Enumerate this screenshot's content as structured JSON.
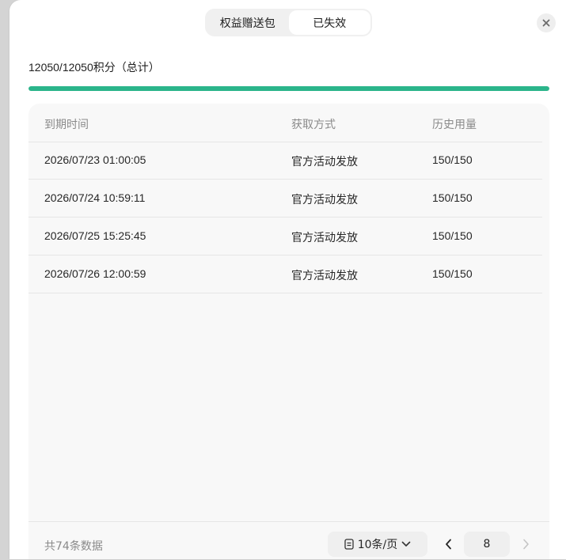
{
  "tabs": [
    {
      "label": "权益赠送包",
      "active": false
    },
    {
      "label": "已失效",
      "active": true
    }
  ],
  "summary": {
    "text": "12050/12050积分（总计）",
    "progress_fraction": 1.0
  },
  "table": {
    "columns": [
      "到期时间",
      "获取方式",
      "历史用量"
    ],
    "rows": [
      [
        "2026/07/23 01:00:05",
        "官方活动发放",
        "150/150"
      ],
      [
        "2026/07/24 10:59:11",
        "官方活动发放",
        "150/150"
      ],
      [
        "2026/07/25 15:25:45",
        "官方活动发放",
        "150/150"
      ],
      [
        "2026/07/26 12:00:59",
        "官方活动发放",
        "150/150"
      ]
    ]
  },
  "footer": {
    "total": "共74条数据",
    "page_size": "10条/页",
    "current_page": "8"
  },
  "icons": {
    "close": "close-icon",
    "page_size": "document-icon",
    "dropdown": "chevron-down-icon",
    "prev": "chevron-left-icon",
    "next": "chevron-right-icon"
  },
  "colors": {
    "accent": "#2bb58b",
    "disabled": "#c4c4c4"
  }
}
